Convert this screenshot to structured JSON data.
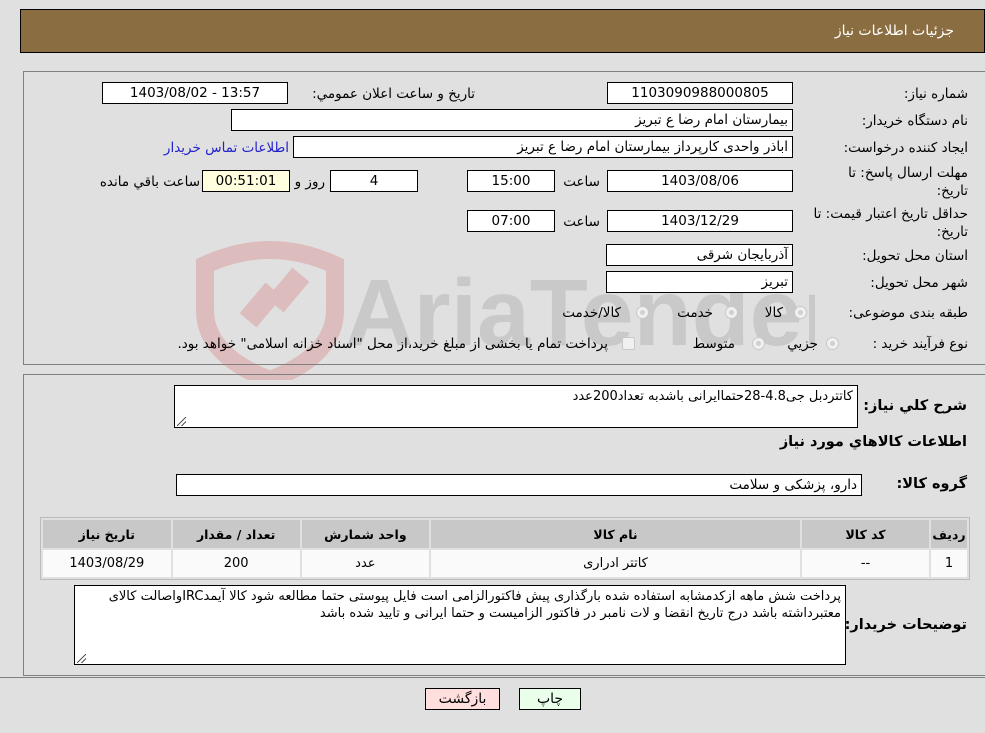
{
  "header": {
    "title": "جزئیات اطلاعات نیاز"
  },
  "fields": {
    "need_number_label": "شماره نیاز:",
    "need_number": "1103090988000805",
    "announce_label": "تاریخ و ساعت اعلان عمومي:",
    "announce_value": "1403/08/02 - 13:57",
    "buyer_org_label": "نام دستگاه خریدار:",
    "buyer_org": "بیمارستان امام رضا  ع  تبریز",
    "creator_label": "ایجاد کننده درخواست:",
    "creator": "اباذر واحدی کارپرداز بیمارستان امام رضا  ع  تبریز",
    "contact_link": "اطلاعات تماس خریدار",
    "deadline_label_line1": "مهلت ارسال پاسخ: تا",
    "deadline_label_line2": "تاریخ:",
    "deadline_date": "1403/08/06",
    "time_label": "ساعت",
    "deadline_time": "15:00",
    "days_value": "4",
    "days_label": "روز و",
    "remaining_time": "00:51:01",
    "remaining_label": "ساعت باقي مانده",
    "validity_label_line1": "حداقل تاریخ اعتبار قیمت: تا",
    "validity_label_line2": "تاریخ:",
    "validity_date": "1403/12/29",
    "validity_time": "07:00",
    "province_label": "استان محل تحویل:",
    "province": "آذربایجان شرقی",
    "city_label": "شهر محل تحویل:",
    "city": "تبریز",
    "category_label": "طبقه بندی موضوعی:",
    "category_options": [
      "کالا",
      "خدمت",
      "کالا/خدمت"
    ],
    "process_label": "نوع فرآیند خرید :",
    "process_options": [
      "جزيي",
      "متوسط"
    ],
    "treasury_note": "پرداخت تمام یا بخشی از مبلغ خرید،از محل \"اسناد خزانه اسلامی\" خواهد بود."
  },
  "details": {
    "summary_label": "شرح کلي نياز:",
    "summary": "کاتتردبل جی4.8-28حتماایرانی باشدبه تعداد200عدد",
    "goods_info_title": "اطلاعات کالاهاي مورد نياز",
    "group_label": "گروه کالا:",
    "group_value": "دارو، پزشکی و سلامت"
  },
  "table": {
    "headers": [
      "ردیف",
      "کد کالا",
      "نام کالا",
      "واحد شمارش",
      "تعداد / مقدار",
      "تاریخ نیاز"
    ],
    "rows": [
      [
        "1",
        "--",
        "کاتتر ادراری",
        "عدد",
        "200",
        "1403/08/29"
      ]
    ]
  },
  "buyer_notes": {
    "label": "توضیحات خریدار:",
    "text": "پرداخت شش ماهه ازکدمشابه استفاده شده بارگذاری پیش فاکتورالزامی است فایل پیوستی حتما مطالعه شود کالا آیمدIRCواصالت کالای معتبرداشته باشد درج تاریخ انقضا و لات نامبر در فاکتور الزامیست و حتما ایرانی و تایید شده باشد"
  },
  "buttons": {
    "print": "چاپ",
    "back": "بازگشت"
  },
  "watermark": {
    "text": "AriaTender.neT"
  },
  "colors": {
    "header_bg": "#8b6d42",
    "print_bg": "#eaffea",
    "back_bg": "#ffdede",
    "link": "#2222cc"
  }
}
